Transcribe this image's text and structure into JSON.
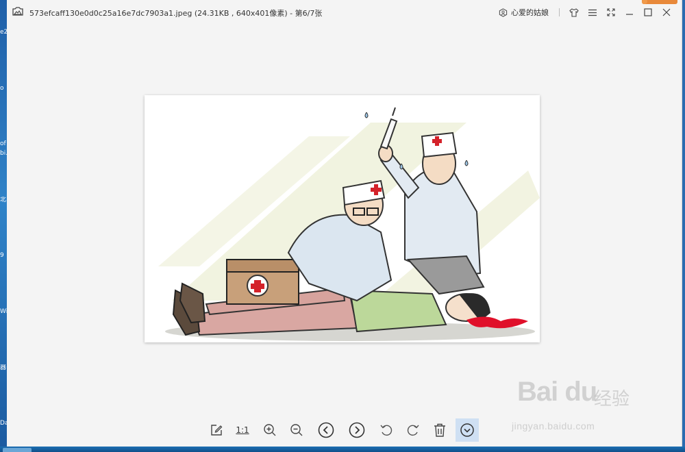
{
  "window": {
    "title": "573efcaff130e0d0c25a16e7dc7903a1.jpeg (24.31KB , 640x401像素) - 第6/7张",
    "user_name": "心爱的姑娘"
  },
  "titlebar_icons": [
    "shirt-skin-icon",
    "menu-icon",
    "fullscreen-icon",
    "minimize-icon",
    "maximize-icon",
    "close-icon"
  ],
  "toolbar": {
    "actual_size_label": "1:1",
    "tools": [
      "edit-icon",
      "actual-size",
      "zoom-in-icon",
      "zoom-out-icon",
      "previous-icon",
      "next-icon",
      "rotate-left-icon",
      "rotate-right-icon",
      "delete-icon",
      "more-down-icon"
    ],
    "active_tool": "more-down-icon"
  },
  "image": {
    "description_alt": "first-aid cartoon"
  },
  "watermark": {
    "brand": "Bai du",
    "brand_cn": "经验",
    "url": "jingyan.baidu.com"
  },
  "desktop_fragments": [
    "e2",
    "o",
    "of",
    "bi.",
    "北",
    "9",
    "Wi",
    "器",
    "Da"
  ],
  "colors": {
    "viewer_bg": "#f4f4f4",
    "accent": "#e8893a",
    "active_tool_bg": "#cfe0f3",
    "desktop": "#2b6cb0"
  }
}
